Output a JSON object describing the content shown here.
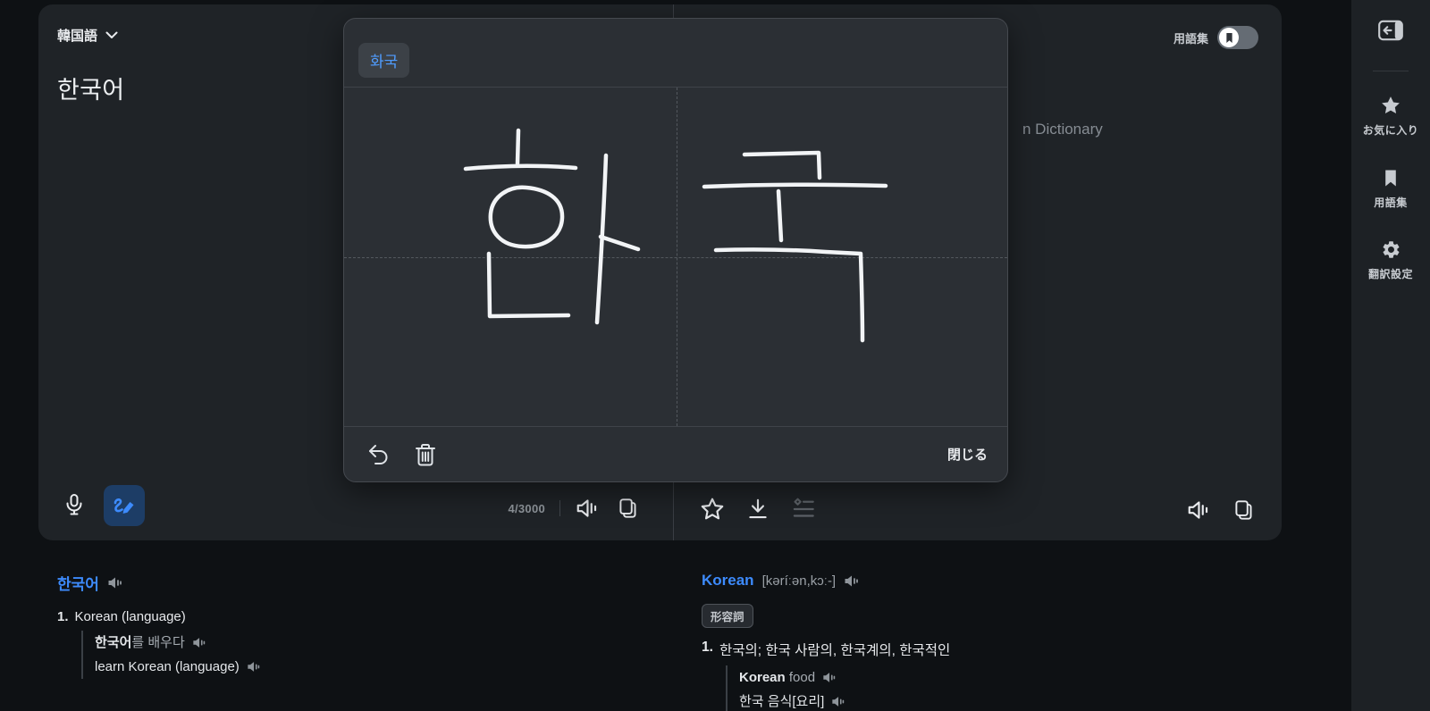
{
  "colors": {
    "accent": "#3d8bfd",
    "page_bg": "#0e1114",
    "card_bg": "#1f2327",
    "panel_bg": "#2b2f34",
    "sidebar_bg": "#1d2125"
  },
  "input_panel": {
    "language_label": "韓国語",
    "source_text": "한국어",
    "char_count": "4/3000"
  },
  "handwriting_panel": {
    "suggestion": "화국",
    "close_label": "閉じる",
    "strokes": [
      "M195 48 L194 85",
      "M136 91 Q200 85 259 90",
      "M204 112 C184 110 166 122 164 141 C162 162 176 177 200 178 C224 179 243 167 244 146 C245 124 226 114 204 112",
      "M293 76 C291 130 287 200 283 263",
      "M287 167 L329 181",
      "M162 186 L163 256 L251 255",
      "M448 75 L531 73 L532 101",
      "M403 111 Q500 107 606 110",
      "M486 116 L489 171",
      "M416 182 Q480 180 539 184 L578 186 C579 220 580 250 580 283"
    ]
  },
  "output_panel": {
    "glossary_label": "用語集",
    "attribution_partial": "n Dictionary"
  },
  "sidebar": {
    "items": [
      {
        "label": "お気に入り"
      },
      {
        "label": "用語集"
      },
      {
        "label": "翻訳設定"
      }
    ]
  },
  "results": {
    "source": {
      "headword": "한국어",
      "senses": [
        {
          "num": "1.",
          "text": "Korean (language)",
          "example": {
            "source_term": "한국어",
            "source_rest": "를 배우다",
            "translation": "learn Korean (language)"
          }
        }
      ]
    },
    "target": {
      "headword": "Korean",
      "pronunciation": "[kəríːən,kɔː-]",
      "pos_badge": "形容詞",
      "senses": [
        {
          "num": "1.",
          "text": "한국의; 한국 사람의, 한국계의, 한국적인",
          "example": {
            "source_term": "Korean",
            "source_rest": " food",
            "translation": "한국 음식[요리]"
          }
        }
      ]
    }
  }
}
